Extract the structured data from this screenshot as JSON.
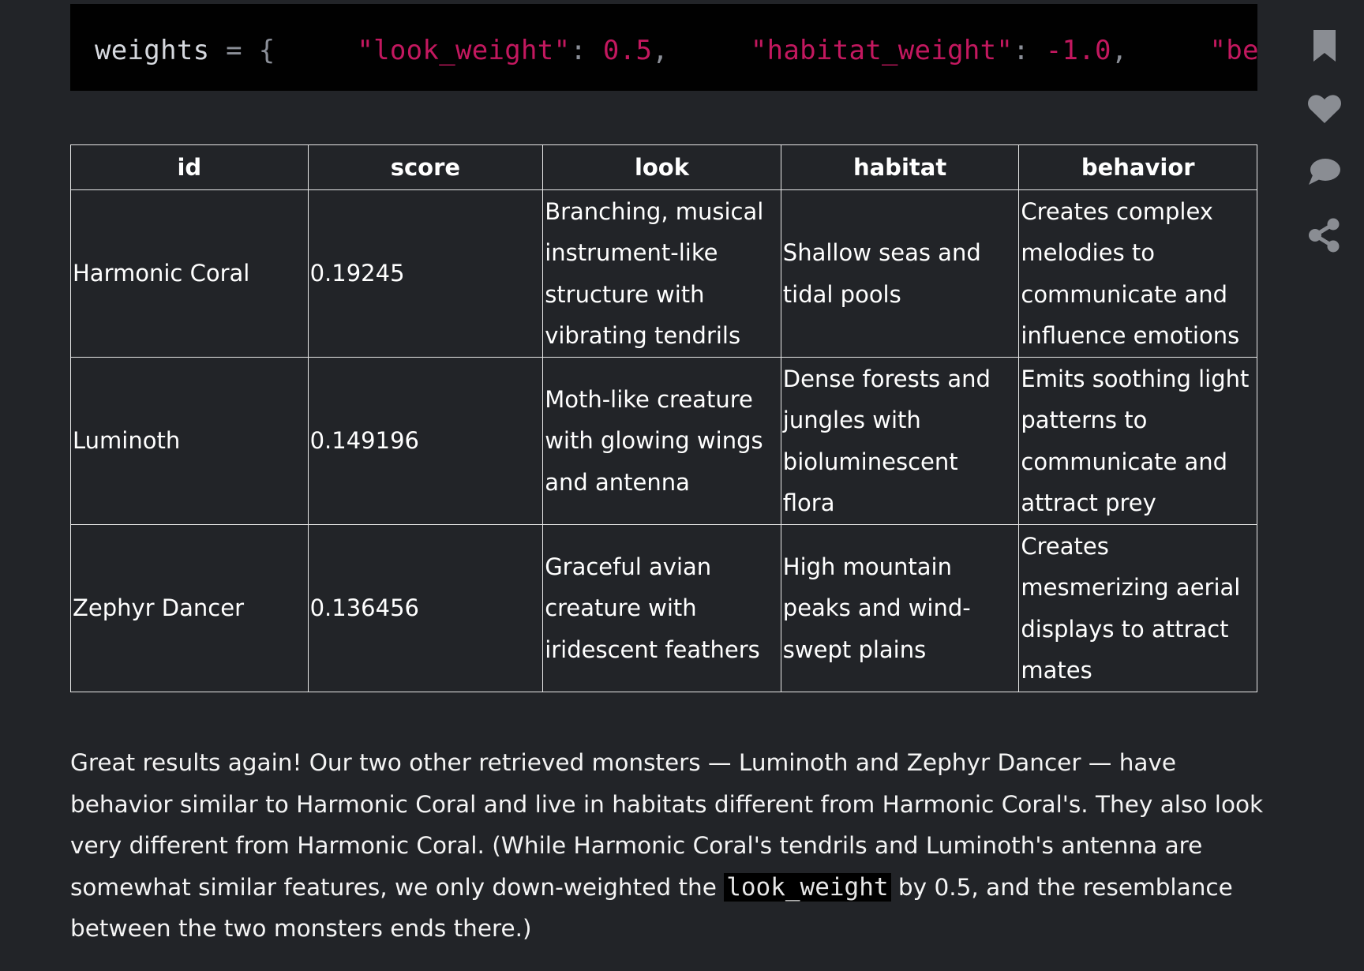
{
  "code": {
    "ident": "weights",
    "op": " = ",
    "brace": "{",
    "gap1": "     ",
    "key1": "\"look_weight\"",
    "colon1": ": ",
    "val1": "0.5",
    "comma1": ",",
    "gap2": "     ",
    "key2": "\"habitat_weight\"",
    "colon2": ": ",
    "val2": "-1.0",
    "comma2": ",",
    "gap3": "     ",
    "key3": "\"behavio"
  },
  "table": {
    "headers": [
      "id",
      "score",
      "look",
      "habitat",
      "behavior"
    ],
    "rows": [
      {
        "id": "Harmonic Coral",
        "score": "0.19245",
        "look": "Branching, musical instrument-like structure with vibrating tendrils",
        "habitat": "Shallow seas and tidal pools",
        "behavior": "Creates complex melodies to communicate and influence emotions"
      },
      {
        "id": "Luminoth",
        "score": "0.149196",
        "look": "Moth-like creature with glowing wings and antenna",
        "habitat": "Dense forests and jungles with bioluminescent flora",
        "behavior": "Emits soothing light patterns to communicate and attract prey"
      },
      {
        "id": "Zephyr Dancer",
        "score": "0.136456",
        "look": "Graceful avian creature with iridescent feathers",
        "habitat": "High mountain peaks and wind-swept plains",
        "behavior": "Creates mesmerizing aerial displays to attract mates"
      }
    ]
  },
  "paragraph": {
    "before": "Great results again! Our two other retrieved monsters — Luminoth and Zephyr Dancer — have behavior similar to Harmonic Coral and live in habitats different from Harmonic Coral's. They also look very different from Harmonic Coral. (While Harmonic Coral's tendrils and Luminoth's antenna are somewhat similar features, we only down-weighted the ",
    "code": "look_weight",
    "after": " by 0.5, and the resemblance between the two monsters ends there.)"
  },
  "rail": {
    "icons": [
      "bookmark-icon",
      "heart-icon",
      "comment-icon",
      "share-icon"
    ],
    "icon_color": "#8a8d93"
  },
  "colors": {
    "background": "#222428",
    "code_background": "#010101",
    "code_string": "#c3185f",
    "text": "#ffffff"
  }
}
